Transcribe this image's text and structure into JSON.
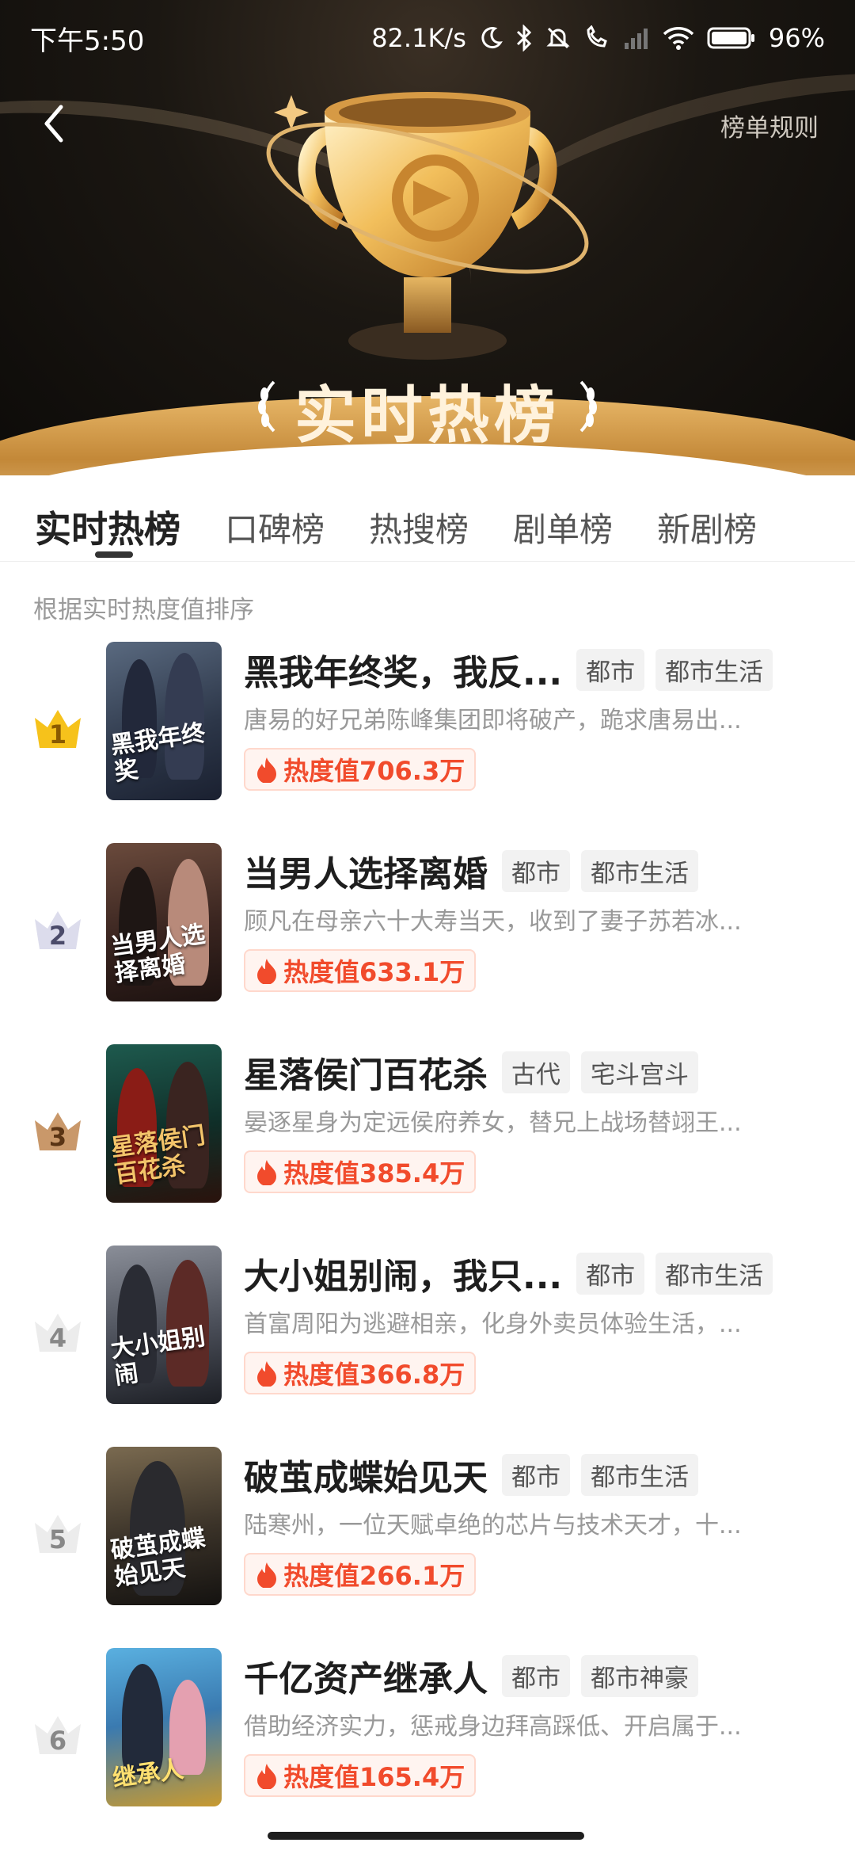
{
  "status_bar": {
    "time": "下午5:50",
    "network_speed": "82.1K/s",
    "battery": "96%",
    "icons": [
      "moon-icon",
      "bluetooth-icon",
      "mute-icon",
      "call-icon",
      "signal-icon",
      "wifi-icon",
      "battery-icon"
    ]
  },
  "header": {
    "rules_link": "榜单规则",
    "title": "实时热榜",
    "back_icon": "back-arrow-icon",
    "trophy_icon": "trophy-icon"
  },
  "tabs": [
    {
      "label": "实时热榜",
      "active": true
    },
    {
      "label": "口碑榜",
      "active": false
    },
    {
      "label": "热搜榜",
      "active": false
    },
    {
      "label": "剧单榜",
      "active": false
    },
    {
      "label": "新剧榜",
      "active": false
    }
  ],
  "sort_hint": "根据实时热度值排序",
  "items": [
    {
      "rank": "1",
      "title": "黑我年终奖，我反...",
      "tags": [
        "都市",
        "都市生活"
      ],
      "desc": "唐易的好兄弟陈峰集团即将破产，跪求唐易出...",
      "heat": "热度值706.3万",
      "poster_text": "黑我年终奖",
      "rank_color": "#f6c21b",
      "rank_text_color": "#8a5a00"
    },
    {
      "rank": "2",
      "title": "当男人选择离婚",
      "tags": [
        "都市",
        "都市生活"
      ],
      "desc": "顾凡在母亲六十大寿当天，收到了妻子苏若冰...",
      "heat": "热度值633.1万",
      "poster_text": "当男人选择离婚",
      "rank_color": "#dcdcec",
      "rank_text_color": "#4b4b6a"
    },
    {
      "rank": "3",
      "title": "星落侯门百花杀",
      "tags": [
        "古代",
        "宅斗宫斗"
      ],
      "desc": "晏逐星身为定远侯府养女，替兄上战场替翊王...",
      "heat": "热度值385.4万",
      "poster_text": "星落侯门百花杀",
      "rank_color": "#c9986a",
      "rank_text_color": "#5a3414"
    },
    {
      "rank": "4",
      "title": "大小姐别闹，我只...",
      "tags": [
        "都市",
        "都市生活"
      ],
      "desc": "首富周阳为逃避相亲，化身外卖员体验生活，...",
      "heat": "热度值366.8万",
      "poster_text": "大小姐别闹",
      "rank_color": "#ececec",
      "rank_text_color": "#888888"
    },
    {
      "rank": "5",
      "title": "破茧成蝶始见天",
      "tags": [
        "都市",
        "都市生活"
      ],
      "desc": "陆寒州，一位天赋卓绝的芯片与技术天才，十...",
      "heat": "热度值266.1万",
      "poster_text": "破茧成蝶始见天",
      "rank_color": "#ececec",
      "rank_text_color": "#888888"
    },
    {
      "rank": "6",
      "title": "千亿资产继承人",
      "tags": [
        "都市",
        "都市神豪"
      ],
      "desc": "借助经济实力，惩戒身边拜高踩低、开启属于...",
      "heat": "热度值165.4万",
      "poster_text": "继承人",
      "rank_color": "#ececec",
      "rank_text_color": "#888888"
    }
  ],
  "colors": {
    "accent_heat": "#f14b2c",
    "gold": "#e7b667"
  }
}
